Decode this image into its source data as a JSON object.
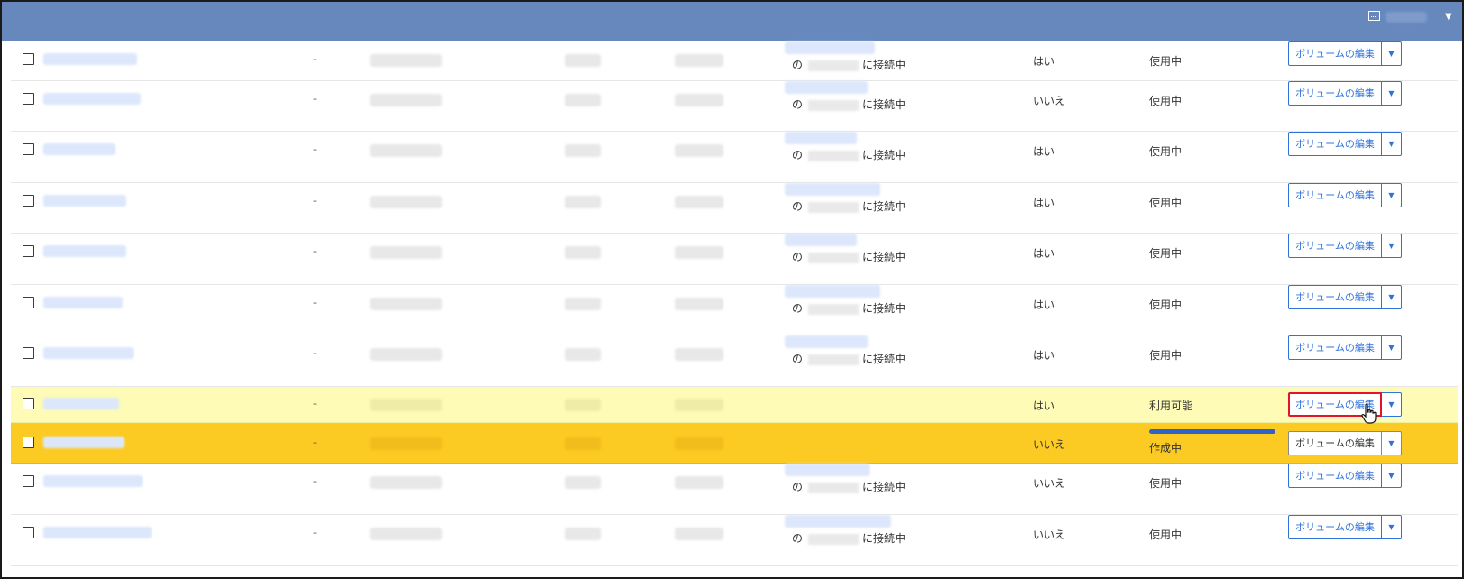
{
  "rows": [
    {
      "dash": "-",
      "conn_prefix": "の",
      "conn_suffix": "に接続中",
      "attached": "はい",
      "state": "使用中",
      "edit_label": "ボリュームの編集",
      "highlight": "none"
    },
    {
      "dash": "-",
      "conn_prefix": "の",
      "conn_suffix": "に接続中",
      "attached": "いいえ",
      "state": "使用中",
      "edit_label": "ボリュームの編集",
      "highlight": "none"
    },
    {
      "dash": "-",
      "conn_prefix": "の",
      "conn_suffix": "に接続中",
      "attached": "はい",
      "state": "使用中",
      "edit_label": "ボリュームの編集",
      "highlight": "none"
    },
    {
      "dash": "-",
      "conn_prefix": "の",
      "conn_suffix": "に接続中",
      "attached": "はい",
      "state": "使用中",
      "edit_label": "ボリュームの編集",
      "highlight": "none"
    },
    {
      "dash": "-",
      "conn_prefix": "の",
      "conn_suffix": "に接続中",
      "attached": "はい",
      "state": "使用中",
      "edit_label": "ボリュームの編集",
      "highlight": "none"
    },
    {
      "dash": "-",
      "conn_prefix": "の",
      "conn_suffix": "に接続中",
      "attached": "はい",
      "state": "使用中",
      "edit_label": "ボリュームの編集",
      "highlight": "none"
    },
    {
      "dash": "-",
      "conn_prefix": "の",
      "conn_suffix": "に接続中",
      "attached": "はい",
      "state": "使用中",
      "edit_label": "ボリュームの編集",
      "highlight": "none"
    },
    {
      "dash": "-",
      "attached": "はい",
      "state": "利用可能",
      "edit_label": "ボリュームの編集",
      "highlight": "yellow"
    },
    {
      "dash": "-",
      "attached": "いいえ",
      "state": "作成中",
      "edit_label": "ボリュームの編集",
      "highlight": "orange",
      "progress": 1.0
    },
    {
      "dash": "-",
      "conn_prefix": "の",
      "conn_suffix": "に接続中",
      "attached": "いいえ",
      "state": "使用中",
      "edit_label": "ボリュームの編集",
      "highlight": "none"
    },
    {
      "dash": "-",
      "conn_prefix": "の",
      "conn_suffix": "に接続中",
      "attached": "いいえ",
      "state": "使用中",
      "edit_label": "ボリュームの編集",
      "highlight": "none"
    }
  ],
  "colors": {
    "header": "#6688bd",
    "link_blue": "#2f73d9",
    "row_available": "#fdfbb6",
    "row_creating": "#fbcb23",
    "focus_outline": "#e5122e"
  },
  "icons": {
    "header_calendar": "calendar-icon",
    "header_caret": "caret-down-icon",
    "dropdown": "caret-down-icon",
    "cursor": "hand-pointer-icon"
  }
}
